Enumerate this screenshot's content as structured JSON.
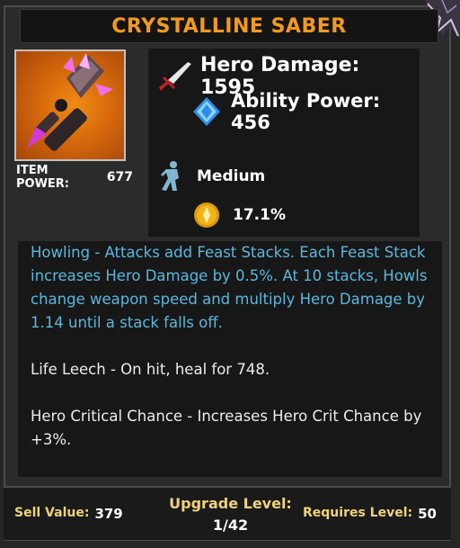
{
  "item": {
    "title": "CRYSTALLINE SABER",
    "item_power_label": "ITEM POWER:",
    "item_power_value": "677"
  },
  "stats": {
    "hero_damage": "Hero Damage: 1595",
    "ability_power": "Ability Power: 456",
    "weight": "Medium",
    "speed": "17.1%"
  },
  "description": {
    "howling": "Howling - Attacks add Feast Stacks. Each Feast Stack increases Hero Damage by 0.5%. At 10 stacks, Howls change weapon speed and multiply Hero Damage by 1.14 until a stack falls off.",
    "life_leech": "Life Leech - On hit, heal for 748.",
    "crit": "Hero Critical Chance - Increases Hero Crit Chance by +3%."
  },
  "footer": {
    "sell_label": "Sell Value:",
    "sell_value": "379",
    "upgrade_label": "Upgrade Level:",
    "upgrade_value": "1/42",
    "requires_label": "Requires Level:",
    "requires_value": "50"
  },
  "icons": {
    "damage": "sword-icon",
    "ability": "blue-diamond-icon",
    "weight": "running-figure-icon",
    "speed": "gold-coin-icon"
  },
  "colors": {
    "title": "#f39a1c",
    "description_accent": "#5ab8de",
    "footer_label": "#f0d27a",
    "ability_icon": "#2a8ee8",
    "coin": "#f2b318"
  }
}
